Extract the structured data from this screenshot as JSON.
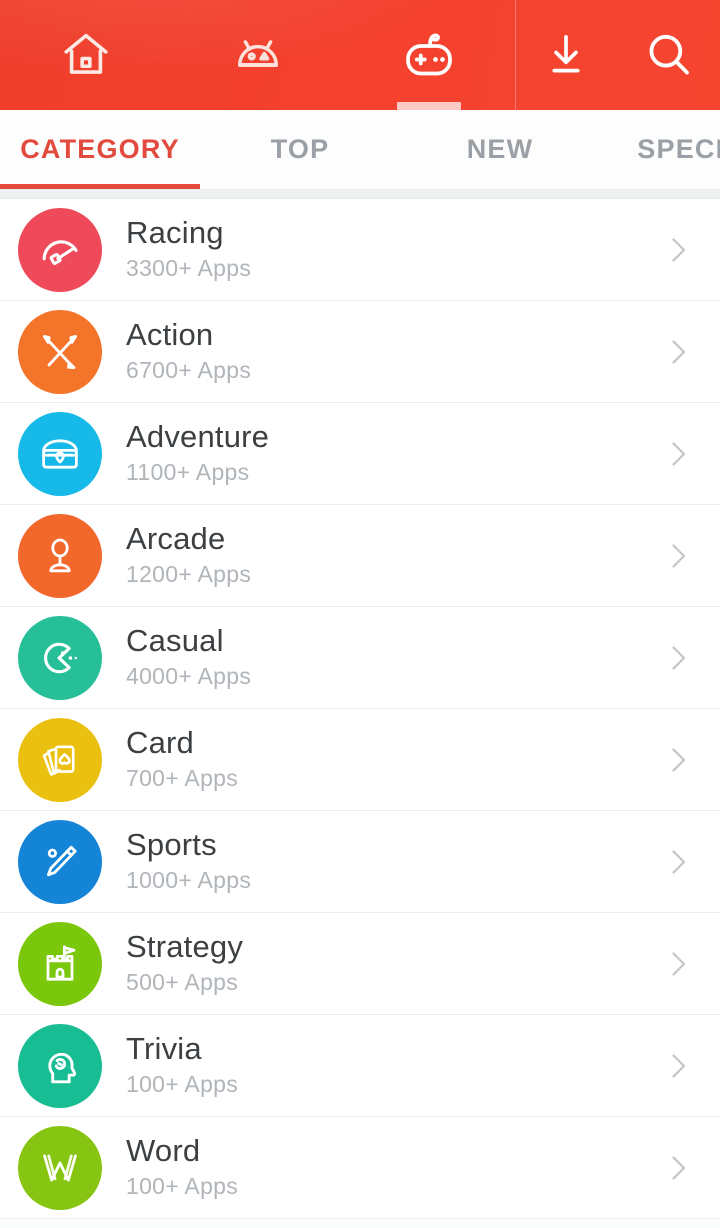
{
  "appbar": {
    "background_color": "#f4402e",
    "items": [
      {
        "name": "home",
        "icon": "home-icon",
        "label": "Home",
        "active": false
      },
      {
        "name": "apps",
        "icon": "android-robot-icon",
        "label": "Apps",
        "active": false
      },
      {
        "name": "games",
        "icon": "gamepad-icon",
        "label": "Games",
        "active": true
      },
      {
        "name": "downloads",
        "icon": "download-icon",
        "label": "Downloads",
        "active": false
      },
      {
        "name": "search",
        "icon": "search-icon",
        "label": "Search",
        "active": false
      }
    ]
  },
  "tabs": {
    "active_index": 0,
    "active_color": "#e24a3d",
    "inactive_color": "#9aa0a6",
    "items": [
      {
        "label": "CATEGORY"
      },
      {
        "label": "TOP"
      },
      {
        "label": "NEW"
      },
      {
        "label": "SPECIAL"
      }
    ]
  },
  "list": {
    "chevron_icon": "chevron-right-icon",
    "items": [
      {
        "title": "Racing",
        "subtitle": "3300+ Apps",
        "color": "#ee4a5a",
        "icon": "speedometer-icon"
      },
      {
        "title": "Action",
        "subtitle": "6700+ Apps",
        "color": "#f4742a",
        "icon": "crossed-swords-icon"
      },
      {
        "title": "Adventure",
        "subtitle": "1100+ Apps",
        "color": "#16b9e8",
        "icon": "treasure-chest-icon"
      },
      {
        "title": "Arcade",
        "subtitle": "1200+ Apps",
        "color": "#f2682a",
        "icon": "joystick-icon"
      },
      {
        "title": "Casual",
        "subtitle": "4000+ Apps",
        "color": "#27bf98",
        "icon": "pacman-icon"
      },
      {
        "title": "Card",
        "subtitle": "700+ Apps",
        "color": "#ebc111",
        "icon": "playing-cards-icon"
      },
      {
        "title": "Sports",
        "subtitle": "1000+ Apps",
        "color": "#1484d6",
        "icon": "whistle-icon"
      },
      {
        "title": "Strategy",
        "subtitle": "500+ Apps",
        "color": "#7ac70c",
        "icon": "castle-flag-icon"
      },
      {
        "title": "Trivia",
        "subtitle": "100+ Apps",
        "color": "#18bd94",
        "icon": "brain-head-icon"
      },
      {
        "title": "Word",
        "subtitle": "100+ Apps",
        "color": "#86c512",
        "icon": "letter-w-icon"
      }
    ]
  }
}
